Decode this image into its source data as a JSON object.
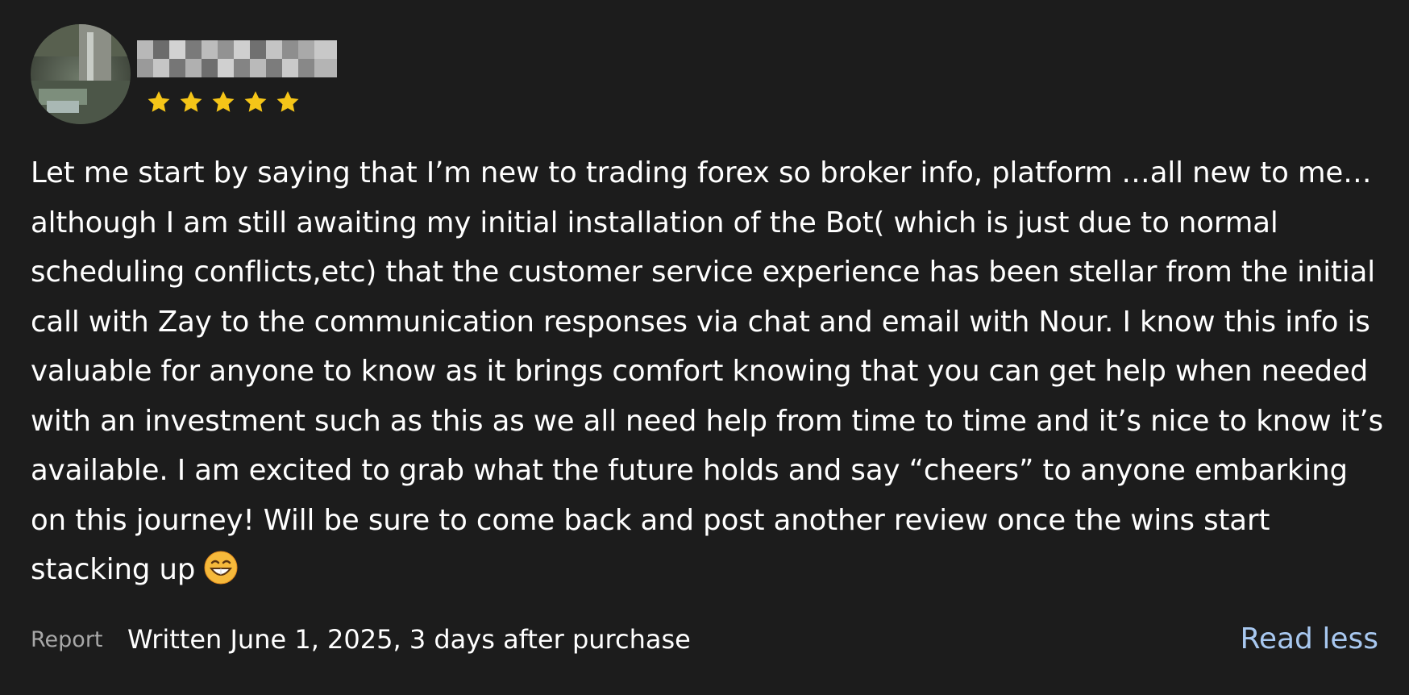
{
  "review": {
    "reviewer": {
      "name": "",
      "avatar_icon": "avatar-photo"
    },
    "rating": {
      "value": 5,
      "max": 5,
      "star_color": "#f5c518",
      "icon": "star-icon"
    },
    "text": "Let me start by saying that I’m new to trading forex so broker info, platform …all new to me…although I am still awaiting my initial installation of the Bot( which is just due to normal scheduling conflicts,etc) that the customer service experience has been stellar from the initial call with Zay to the communication responses via chat and email with Nour. I know this info is valuable for anyone to know as it brings comfort knowing that you can get help when needed with an investment such as this as we all need help from time to time and it’s nice to know it’s available. I am excited to grab what the future holds and say “cheers” to anyone embarking on this journey! Will be sure to come back and post another review once the wins start stacking up",
    "emoji": "😁",
    "emoji_icon": "grinning-face-icon"
  },
  "footer": {
    "report_label": "Report",
    "written_label": "Written June 1, 2025, 3 days after purchase",
    "read_less_label": "Read less"
  },
  "colors": {
    "background": "#1c1c1c",
    "text": "#ffffff",
    "muted": "#a8a8a8",
    "link": "#a8c8f0",
    "star": "#f5c518"
  }
}
